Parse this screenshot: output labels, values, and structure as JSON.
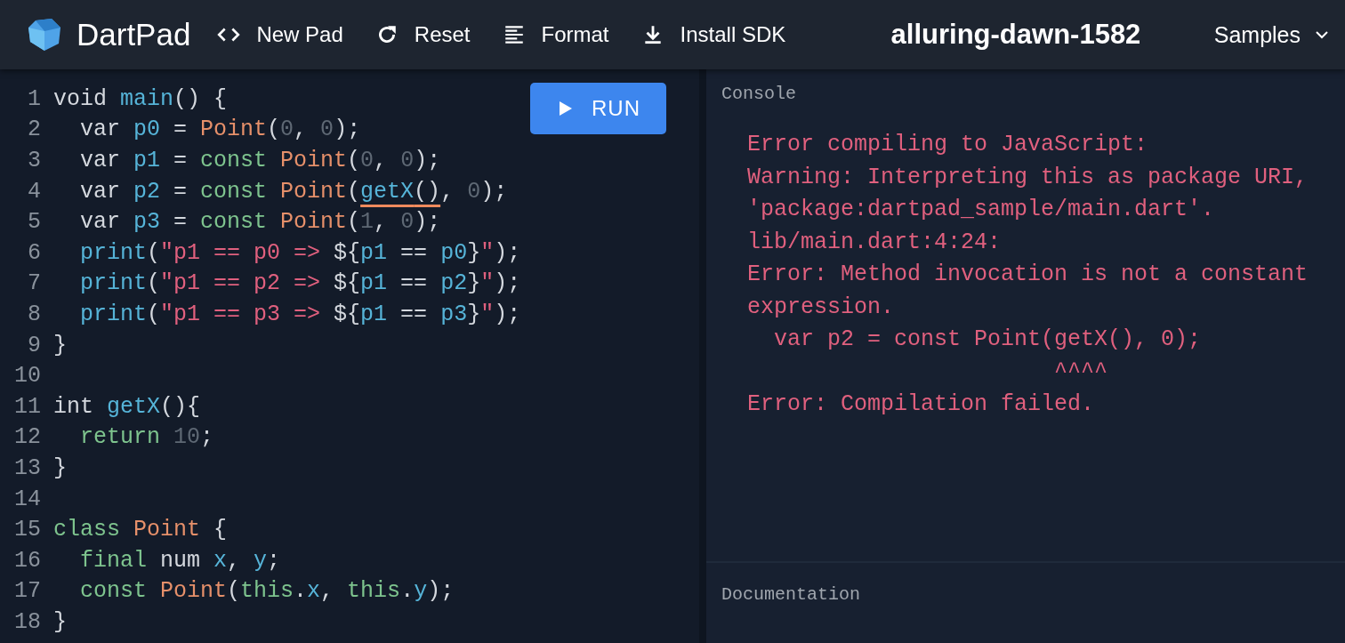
{
  "header": {
    "app_name": "DartPad",
    "actions": [
      {
        "kind": "code",
        "label": "New Pad"
      },
      {
        "kind": "reset",
        "label": "Reset"
      },
      {
        "kind": "format",
        "label": "Format"
      },
      {
        "kind": "download",
        "label": "Install SDK"
      }
    ],
    "pad_title": "alluring-dawn-1582",
    "samples": {
      "label": "Samples"
    }
  },
  "editor": {
    "run_button": {
      "label": "RUN"
    },
    "lines": [
      {
        "number": "1",
        "indented": false,
        "tokens": [
          {
            "kind": "plain",
            "t": "void "
          },
          {
            "kind": "ident",
            "t": "main"
          },
          {
            "kind": "plain",
            "t": "() {"
          }
        ]
      },
      {
        "number": "2",
        "indented": true,
        "tokens": [
          {
            "kind": "plain",
            "t": "var "
          },
          {
            "kind": "ident",
            "t": "p0"
          },
          {
            "kind": "plain",
            "t": " = "
          },
          {
            "kind": "type",
            "t": "Point"
          },
          {
            "kind": "plain",
            "t": "("
          },
          {
            "kind": "number",
            "t": "0"
          },
          {
            "kind": "plain",
            "t": ", "
          },
          {
            "kind": "number",
            "t": "0"
          },
          {
            "kind": "plain",
            "t": ");"
          }
        ]
      },
      {
        "number": "3",
        "indented": true,
        "tokens": [
          {
            "kind": "plain",
            "t": "var "
          },
          {
            "kind": "ident",
            "t": "p1"
          },
          {
            "kind": "plain",
            "t": " = "
          },
          {
            "kind": "decl",
            "t": "const "
          },
          {
            "kind": "type",
            "t": "Point"
          },
          {
            "kind": "plain",
            "t": "("
          },
          {
            "kind": "number",
            "t": "0"
          },
          {
            "kind": "plain",
            "t": ", "
          },
          {
            "kind": "number",
            "t": "0"
          },
          {
            "kind": "plain",
            "t": ");"
          }
        ]
      },
      {
        "number": "4",
        "indented": true,
        "tokens": [
          {
            "kind": "plain",
            "t": "var "
          },
          {
            "kind": "ident",
            "t": "p2"
          },
          {
            "kind": "plain",
            "t": " = "
          },
          {
            "kind": "decl",
            "t": "const "
          },
          {
            "kind": "type",
            "t": "Point"
          },
          {
            "kind": "plain",
            "t": "("
          },
          {
            "kind": "ident",
            "t": "getX",
            "error": true
          },
          {
            "kind": "plain",
            "t": "()",
            "error": true
          },
          {
            "kind": "plain",
            "t": ", "
          },
          {
            "kind": "number",
            "t": "0"
          },
          {
            "kind": "plain",
            "t": ");"
          }
        ]
      },
      {
        "number": "5",
        "indented": true,
        "tokens": [
          {
            "kind": "plain",
            "t": "var "
          },
          {
            "kind": "ident",
            "t": "p3"
          },
          {
            "kind": "plain",
            "t": " = "
          },
          {
            "kind": "decl",
            "t": "const "
          },
          {
            "kind": "type",
            "t": "Point"
          },
          {
            "kind": "plain",
            "t": "("
          },
          {
            "kind": "number",
            "t": "1"
          },
          {
            "kind": "plain",
            "t": ", "
          },
          {
            "kind": "number",
            "t": "0"
          },
          {
            "kind": "plain",
            "t": ");"
          }
        ]
      },
      {
        "number": "6",
        "indented": true,
        "tokens": [
          {
            "kind": "ident",
            "t": "print"
          },
          {
            "kind": "plain",
            "t": "("
          },
          {
            "kind": "string",
            "t": "\"p1 == p0 => "
          },
          {
            "kind": "plain",
            "t": "${"
          },
          {
            "kind": "ident",
            "t": "p1"
          },
          {
            "kind": "plain",
            "t": " == "
          },
          {
            "kind": "ident",
            "t": "p0"
          },
          {
            "kind": "plain",
            "t": "}"
          },
          {
            "kind": "string",
            "t": "\""
          },
          {
            "kind": "plain",
            "t": ");"
          }
        ]
      },
      {
        "number": "7",
        "indented": true,
        "tokens": [
          {
            "kind": "ident",
            "t": "print"
          },
          {
            "kind": "plain",
            "t": "("
          },
          {
            "kind": "string",
            "t": "\"p1 == p2 => "
          },
          {
            "kind": "plain",
            "t": "${"
          },
          {
            "kind": "ident",
            "t": "p1"
          },
          {
            "kind": "plain",
            "t": " == "
          },
          {
            "kind": "ident",
            "t": "p2"
          },
          {
            "kind": "plain",
            "t": "}"
          },
          {
            "kind": "string",
            "t": "\""
          },
          {
            "kind": "plain",
            "t": ");"
          }
        ]
      },
      {
        "number": "8",
        "indented": true,
        "tokens": [
          {
            "kind": "ident",
            "t": "print"
          },
          {
            "kind": "plain",
            "t": "("
          },
          {
            "kind": "string",
            "t": "\"p1 == p3 => "
          },
          {
            "kind": "plain",
            "t": "${"
          },
          {
            "kind": "ident",
            "t": "p1"
          },
          {
            "kind": "plain",
            "t": " == "
          },
          {
            "kind": "ident",
            "t": "p3"
          },
          {
            "kind": "plain",
            "t": "}"
          },
          {
            "kind": "string",
            "t": "\""
          },
          {
            "kind": "plain",
            "t": ");"
          }
        ]
      },
      {
        "number": "9",
        "indented": false,
        "tokens": [
          {
            "kind": "plain",
            "t": "}"
          }
        ]
      },
      {
        "number": "10"
      },
      {
        "number": "11",
        "indented": false,
        "tokens": [
          {
            "kind": "plain",
            "t": "int "
          },
          {
            "kind": "ident",
            "t": "getX"
          },
          {
            "kind": "plain",
            "t": "(){"
          }
        ]
      },
      {
        "number": "12",
        "indented": true,
        "tokens": [
          {
            "kind": "decl",
            "t": "return "
          },
          {
            "kind": "number",
            "t": "10"
          },
          {
            "kind": "plain",
            "t": ";"
          }
        ]
      },
      {
        "number": "13",
        "indented": false,
        "tokens": [
          {
            "kind": "plain",
            "t": "}"
          }
        ]
      },
      {
        "number": "14"
      },
      {
        "number": "15",
        "indented": false,
        "tokens": [
          {
            "kind": "decl",
            "t": "class "
          },
          {
            "kind": "type",
            "t": "Point"
          },
          {
            "kind": "plain",
            "t": " {"
          }
        ]
      },
      {
        "number": "16",
        "indented": true,
        "tokens": [
          {
            "kind": "decl",
            "t": "final "
          },
          {
            "kind": "plain",
            "t": "num "
          },
          {
            "kind": "ident",
            "t": "x"
          },
          {
            "kind": "plain",
            "t": ", "
          },
          {
            "kind": "ident",
            "t": "y"
          },
          {
            "kind": "plain",
            "t": ";"
          }
        ]
      },
      {
        "number": "17",
        "indented": true,
        "tokens": [
          {
            "kind": "decl",
            "t": "const "
          },
          {
            "kind": "type",
            "t": "Point"
          },
          {
            "kind": "plain",
            "t": "("
          },
          {
            "kind": "decl",
            "t": "this"
          },
          {
            "kind": "plain",
            "t": "."
          },
          {
            "kind": "ident",
            "t": "x"
          },
          {
            "kind": "plain",
            "t": ", "
          },
          {
            "kind": "decl",
            "t": "this"
          },
          {
            "kind": "plain",
            "t": "."
          },
          {
            "kind": "ident",
            "t": "y"
          },
          {
            "kind": "plain",
            "t": ");"
          }
        ]
      },
      {
        "number": "18",
        "indented": false,
        "tokens": [
          {
            "kind": "plain",
            "t": "}"
          }
        ]
      }
    ]
  },
  "console": {
    "title": "Console",
    "lines": [
      "Error compiling to JavaScript:",
      "Warning: Interpreting this as package URI,",
      "'package:dartpad_sample/main.dart'.",
      "lib/main.dart:4:24:",
      "Error: Method invocation is not a constant",
      "expression.",
      "  var p2 = const Point(getX(), 0);",
      "                       ^^^^",
      "Error: Compilation failed."
    ]
  },
  "documentation": {
    "title": "Documentation"
  }
}
